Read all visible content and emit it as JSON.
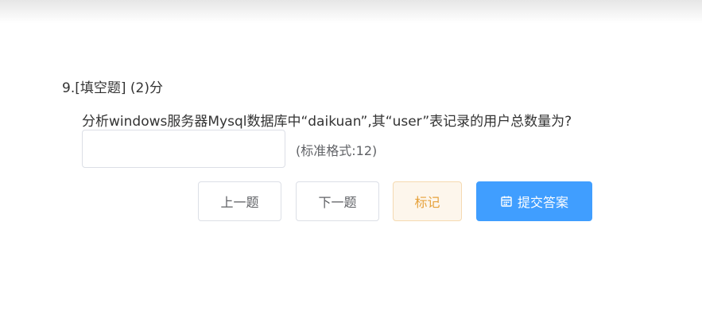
{
  "question": {
    "title": "9.[填空题] (2)分",
    "text": "分析windows服务器Mysql数据库中“daikuan”,其“user”表记录的用户总数量为?",
    "answer_value": "",
    "format_hint": "(标准格式:12)"
  },
  "buttons": {
    "prev": "上一题",
    "next": "下一题",
    "mark": "标记",
    "submit": "提交答案",
    "submit_icon": "calendar-icon"
  },
  "colors": {
    "primary": "#409eff",
    "warning": "#e6a23c",
    "warning_bg": "#fdf6ec"
  }
}
